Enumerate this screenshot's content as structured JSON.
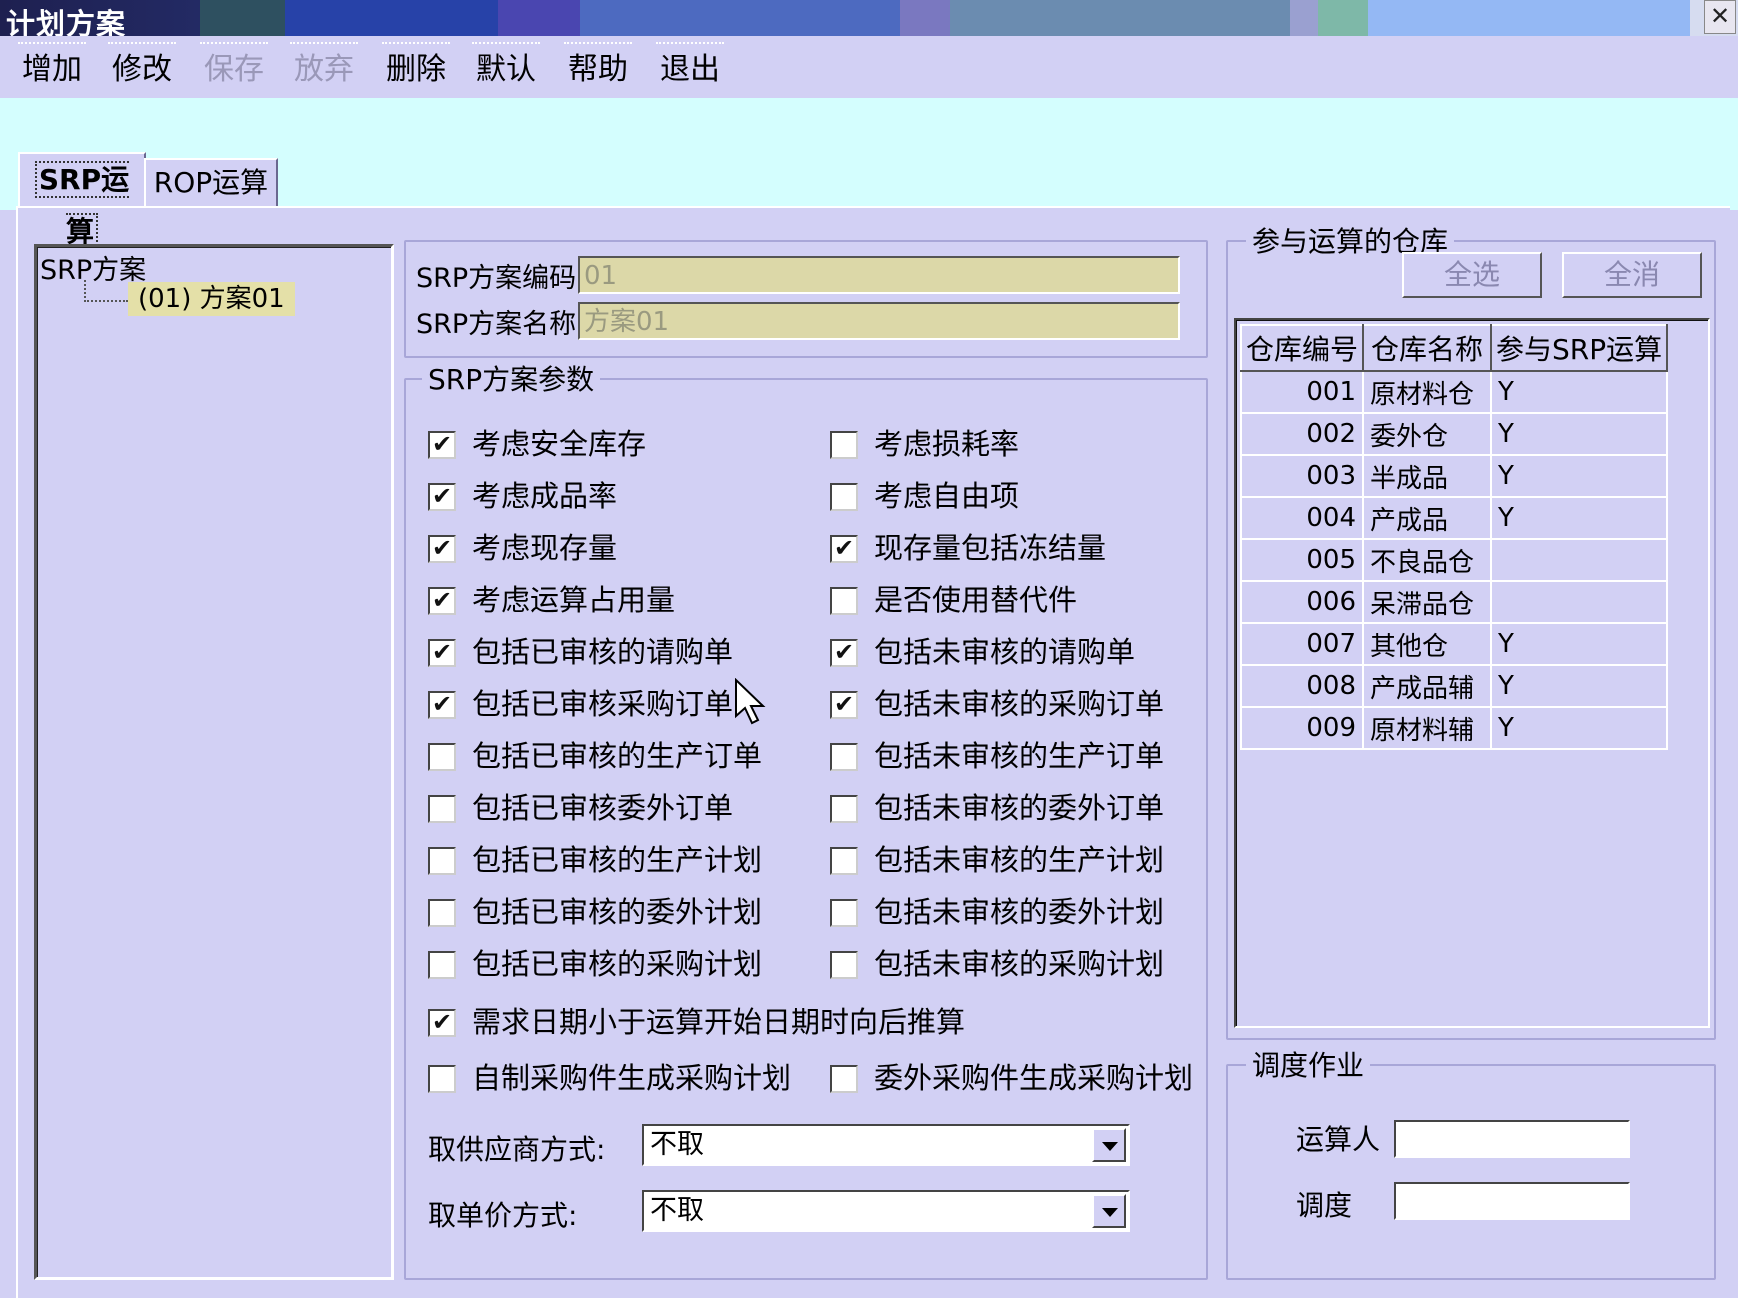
{
  "window": {
    "title": "计划方案",
    "close": "✕"
  },
  "toolbar": {
    "add": "增加",
    "edit": "修改",
    "save": "保存",
    "discard": "放弃",
    "delete": "删除",
    "default": "默认",
    "help": "帮助",
    "exit": "退出"
  },
  "tabs": {
    "srp": "SRP运算",
    "rop": "ROP运算"
  },
  "tree": {
    "root": "SRP方案",
    "child": "(01) 方案01"
  },
  "scheme": {
    "code_label": "SRP方案编码",
    "code_value": "01",
    "name_label": "SRP方案名称",
    "name_value": "方案01"
  },
  "params": {
    "group_label": "SRP方案参数",
    "left": [
      {
        "label": "考虑安全库存",
        "checked": true
      },
      {
        "label": "考虑成品率",
        "checked": true
      },
      {
        "label": "考虑现存量",
        "checked": true
      },
      {
        "label": "考虑运算占用量",
        "checked": true
      },
      {
        "label": "包括已审核的请购单",
        "checked": true
      },
      {
        "label": "包括已审核采购订单",
        "checked": true
      },
      {
        "label": "包括已审核的生产订单",
        "checked": false
      },
      {
        "label": "包括已审核委外订单",
        "checked": false
      },
      {
        "label": "包括已审核的生产计划",
        "checked": false
      },
      {
        "label": "包括已审核的委外计划",
        "checked": false
      },
      {
        "label": "包括已审核的采购计划",
        "checked": false
      }
    ],
    "right": [
      {
        "label": "考虑损耗率",
        "checked": false
      },
      {
        "label": "考虑自由项",
        "checked": false
      },
      {
        "label": "现存量包括冻结量",
        "checked": true
      },
      {
        "label": "是否使用替代件",
        "checked": false
      },
      {
        "label": "包括未审核的请购单",
        "checked": true
      },
      {
        "label": "包括未审核的采购订单",
        "checked": true
      },
      {
        "label": "包括未审核的生产订单",
        "checked": false
      },
      {
        "label": "包括未审核的委外订单",
        "checked": false
      },
      {
        "label": "包括未审核的生产计划",
        "checked": false
      },
      {
        "label": "包括未审核的委外计划",
        "checked": false
      },
      {
        "label": "包括未审核的采购计划",
        "checked": false
      }
    ],
    "backward": {
      "label": "需求日期小于运算开始日期时向后推算",
      "checked": true
    },
    "self_made": {
      "label": "自制采购件生成采购计划",
      "checked": false
    },
    "outsourced": {
      "label": "委外采购件生成采购计划",
      "checked": false
    },
    "supplier_label": "取供应商方式:",
    "supplier_value": "不取",
    "price_label": "取单价方式:",
    "price_value": "不取"
  },
  "warehouses": {
    "group_label": "参与运算的仓库",
    "select_all": "全选",
    "deselect_all": "全消",
    "columns": [
      "仓库编号",
      "仓库名称",
      "参与SRP运算"
    ],
    "rows": [
      [
        "001",
        "原材料仓",
        "Y"
      ],
      [
        "002",
        "委外仓",
        "Y"
      ],
      [
        "003",
        "半成品",
        "Y"
      ],
      [
        "004",
        "产成品",
        "Y"
      ],
      [
        "005",
        "不良品仓",
        ""
      ],
      [
        "006",
        "呆滞品仓",
        ""
      ],
      [
        "007",
        "其他仓",
        "Y"
      ],
      [
        "008",
        "产成品辅",
        "Y"
      ],
      [
        "009",
        "原材料辅",
        "Y"
      ]
    ]
  },
  "dispatch": {
    "group_label": "调度作业",
    "operator_label": "运算人",
    "schedule_label": "调度"
  }
}
